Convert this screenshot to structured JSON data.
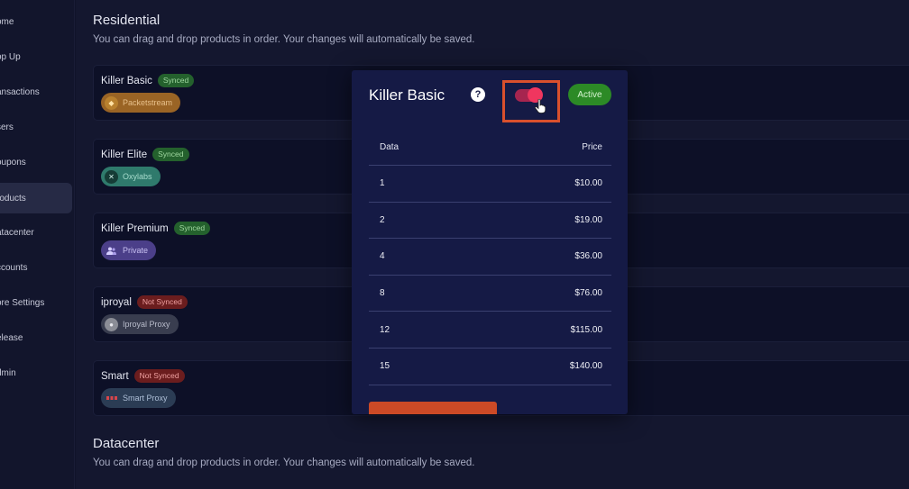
{
  "sidebar": {
    "items": [
      {
        "label": "ome",
        "active": false
      },
      {
        "label": "op Up",
        "active": false
      },
      {
        "label": "ansactions",
        "active": false
      },
      {
        "label": "sers",
        "active": false
      },
      {
        "label": "oupons",
        "active": false
      },
      {
        "label": "roducts",
        "active": true
      },
      {
        "label": "atacenter",
        "active": false
      },
      {
        "label": "ccounts",
        "active": false
      },
      {
        "label": "ore Settings",
        "active": false
      },
      {
        "label": "elease",
        "active": false
      },
      {
        "label": "dmin",
        "active": false
      }
    ]
  },
  "residential": {
    "title": "Residential",
    "subtitle": "You can drag and drop products in order. Your changes will automatically be saved.",
    "products": [
      {
        "name": "Killer Basic",
        "status": "Synced",
        "provider": "Packetstream",
        "provider_icon": "packetstream-icon"
      },
      {
        "name": "Killer Elite",
        "status": "Synced",
        "provider": "Oxylabs",
        "provider_icon": "oxylabs-icon"
      },
      {
        "name": "Killer Premium",
        "status": "Synced",
        "provider": "Private",
        "provider_icon": "users-icon"
      },
      {
        "name": "iproyal",
        "status": "Not Synced",
        "provider": "Iproyal Proxy",
        "provider_icon": "iproyal-icon"
      },
      {
        "name": "Smart",
        "status": "Not Synced",
        "provider": "Smart Proxy",
        "provider_icon": "smartproxy-icon"
      }
    ]
  },
  "datacenter": {
    "title": "Datacenter",
    "subtitle": "You can drag and drop products in order. Your changes will automatically be saved."
  },
  "modal": {
    "title": "Killer Basic",
    "help_glyph": "?",
    "toggle_on": true,
    "status_label": "Active",
    "table": {
      "headers": {
        "data": "Data",
        "price": "Price"
      },
      "rows": [
        {
          "data": "1",
          "price": "$10.00"
        },
        {
          "data": "2",
          "price": "$19.00"
        },
        {
          "data": "4",
          "price": "$36.00"
        },
        {
          "data": "8",
          "price": "$76.00"
        },
        {
          "data": "12",
          "price": "$115.00"
        },
        {
          "data": "15",
          "price": "$140.00"
        }
      ]
    }
  },
  "colors": {
    "background": "#10132a",
    "modal": "#151a45",
    "accent_orange": "#cc4a26",
    "toggle": "#f0365f",
    "active_green": "#2c8a26",
    "synced_green": "#24612d",
    "not_synced_red": "#6b1d1e"
  }
}
